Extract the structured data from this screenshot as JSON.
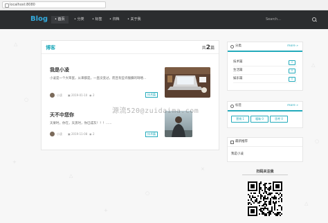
{
  "browser": {
    "url": "localhost:8080"
  },
  "nav": {
    "logo": "Blog",
    "items": [
      {
        "label": "• 首页"
      },
      {
        "label": "• 分类"
      },
      {
        "label": "• 标签"
      },
      {
        "label": "• 归档"
      },
      {
        "label": "• 关于我"
      }
    ],
    "search_placeholder": "Search..."
  },
  "main": {
    "title": "博客",
    "count_prefix": "共",
    "count": "2",
    "count_suffix": "篇",
    "posts": [
      {
        "title": "我是小凌",
        "excerpt": "小凌是一个大笨蛋，从来都是，一直没变过，而且有些许腼腆的呀嘻...",
        "author": "小凌",
        "date": "2019-01-10",
        "views": "2",
        "tag": "技术篇"
      },
      {
        "title": "天不中您你",
        "excerpt": "天果时，你在，天黑时，你已成灰！！！......",
        "author": "小凌",
        "date": "2019-11-08",
        "views": "2",
        "tag": "技术篇"
      }
    ]
  },
  "watermark": "源流520@zuidaima.com",
  "sidebar": {
    "categories": {
      "title": "分类",
      "more": "more »",
      "items": [
        {
          "name": "技术篇",
          "count": "2"
        },
        {
          "name": "生活篇",
          "count": "0"
        },
        {
          "name": "娱乐篇",
          "count": "0"
        }
      ]
    },
    "tags": {
      "title": "标签",
      "more": "more »",
      "items": [
        {
          "name": "营销",
          "count": "1"
        },
        {
          "name": "暧昧",
          "count": "0"
        },
        {
          "name": "思考",
          "count": "0"
        }
      ]
    },
    "recommend": {
      "title": "最新推荐",
      "items": [
        {
          "title": "我是小凌"
        }
      ]
    },
    "qr": {
      "title": "扫码关注我"
    }
  }
}
